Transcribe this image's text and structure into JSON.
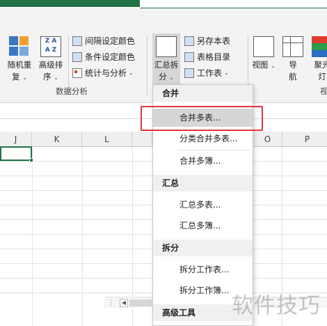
{
  "ribbon": {
    "random_button": {
      "line1": "随机重",
      "line2": "复"
    },
    "sort_button": {
      "line1": "高级排",
      "line2": "序"
    },
    "interval_color": "间隔设定颜色",
    "condition_color": "条件设定颜色",
    "stat_analysis": "统计与分析",
    "group_data_analysis": "数据分析",
    "summary_split": {
      "line1": "汇总拆",
      "line2": "分"
    },
    "save_as_book": "另存本表",
    "sheet_directory": "表格目录",
    "worksheet": "工作表",
    "view": "视图",
    "nav": {
      "line1": "导",
      "line2": "航"
    },
    "spotlight": {
      "line1": "聚光",
      "line2": "灯"
    },
    "group_view_partial": "视"
  },
  "columns": [
    "J",
    "K",
    "L",
    "O",
    "P"
  ],
  "menu": {
    "section_merge": "合并",
    "merge_sheets": "合并多表...",
    "category_merge": "分类合并多表...",
    "merge_books": "合并多簿...",
    "section_summary": "汇总",
    "summary_sheets": "汇总多表...",
    "summary_books": "汇总多簿...",
    "section_split": "拆分",
    "split_sheet": "拆分工作表...",
    "split_book": "拆分工作簿...",
    "section_advanced": "高级工具"
  },
  "watermark": "软件技巧"
}
